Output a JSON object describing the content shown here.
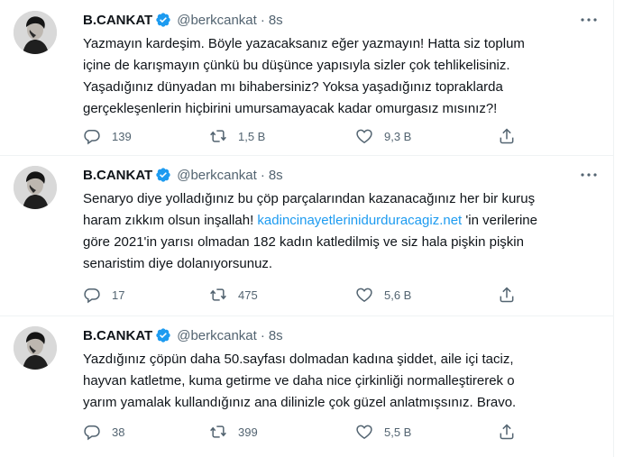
{
  "tweets": [
    {
      "display_name": "B.CANKAT",
      "handle": "@berkcankat",
      "separator": "·",
      "time": "8s",
      "text_lines": [
        "Yazmayın kardeşim. Böyle yazacaksanız eğer yazmayın! Hatta siz toplum",
        "içine de karışmayın çünkü bu düşünce yapısıyla sizler çok tehlikelisiniz.",
        "Yaşadığınız dünyadan mı bihabersiniz? Yoksa yaşadığınız topraklarda",
        "gerçekleşenlerin hiçbirini umursamayacak kadar omurgasız mısınız?!"
      ],
      "replies": "139",
      "retweets": "1,5 B",
      "likes": "9,3 B"
    },
    {
      "display_name": "B.CANKAT",
      "handle": "@berkcankat",
      "separator": "·",
      "time": "8s",
      "text_lines": [
        "Senaryo diye yolladığınız bu çöp parçalarından kazanacağınız her bir kuruş",
        "haram zıkkım olsun inşallah! ",
        "kadincinayetlerinidurduracagiz.net",
        " 'in verilerine",
        "göre 2021'in yarısı olmadan 182 kadın katledilmiş ve siz hala pişkin pişkin",
        "senaristim diye dolanıyorsunuz."
      ],
      "replies": "17",
      "retweets": "475",
      "likes": "5,6 B"
    },
    {
      "display_name": "B.CANKAT",
      "handle": "@berkcankat",
      "separator": "·",
      "time": "8s",
      "text_lines": [
        "Yazdığınız çöpün daha 50.sayfası dolmadan kadına şiddet, aile içi taciz,",
        "hayvan katletme, kuma getirme ve daha nice çirkinliği normalleştirerek o",
        "yarım yamalak kullandığınız ana dilinizle çok güzel anlatmışsınız. Bravo."
      ],
      "replies": "38",
      "retweets": "399",
      "likes": "5,5 B"
    }
  ],
  "icons": {
    "verified": "verified-badge-icon",
    "more": "more-options-icon",
    "reply": "reply-icon",
    "retweet": "retweet-icon",
    "like": "like-icon",
    "share": "share-icon"
  },
  "colors": {
    "text_primary": "#0f1419",
    "text_secondary": "#536471",
    "link": "#1d9bf0",
    "verified": "#1d9bf0",
    "divider": "#eff3f4"
  }
}
